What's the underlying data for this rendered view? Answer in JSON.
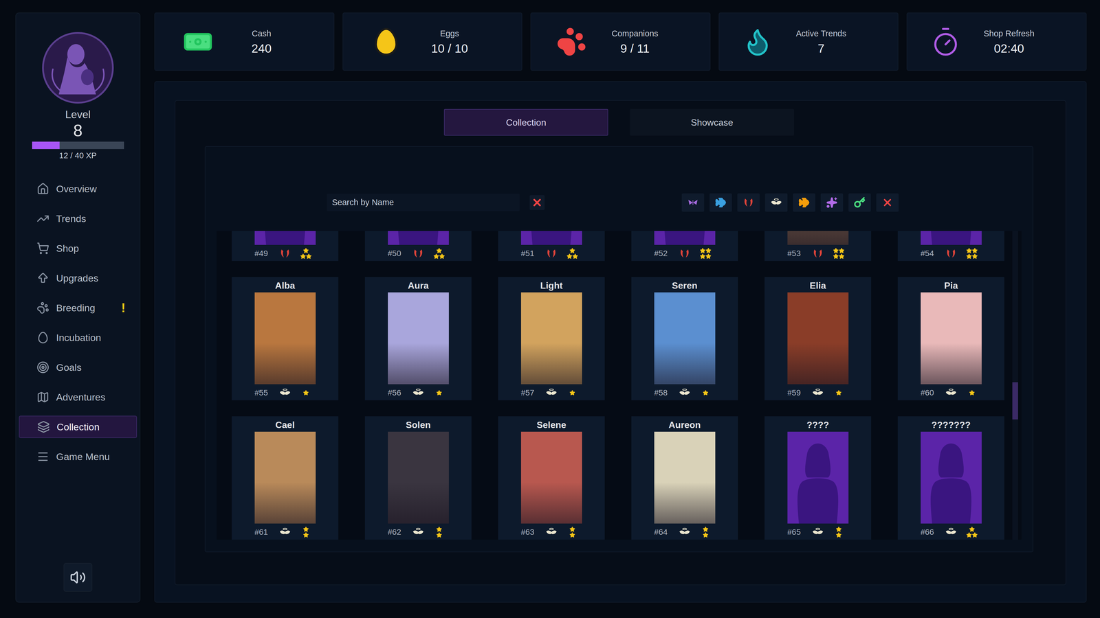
{
  "sidebar": {
    "level_label": "Level",
    "level": "8",
    "xp": {
      "level": 0.3,
      "reading": "12 / 40 XP"
    },
    "items": [
      {
        "label": "Overview",
        "selected": false,
        "badge": ""
      },
      {
        "label": "Trends",
        "selected": false,
        "badge": ""
      },
      {
        "label": "Shop",
        "selected": false,
        "badge": ""
      },
      {
        "label": "Upgrades",
        "selected": false,
        "badge": ""
      },
      {
        "label": "Breeding",
        "selected": false,
        "badge": "!"
      },
      {
        "label": "Incubation",
        "selected": false,
        "badge": ""
      },
      {
        "label": "Goals",
        "selected": false,
        "badge": ""
      },
      {
        "label": "Adventures",
        "selected": false,
        "badge": ""
      },
      {
        "label": "Collection",
        "selected": true,
        "badge": ""
      },
      {
        "label": "Game Menu",
        "selected": false,
        "badge": ""
      }
    ]
  },
  "stats": [
    {
      "label": "Cash",
      "value": "240"
    },
    {
      "label": "Eggs",
      "value": "10 / 10"
    },
    {
      "label": "Companions",
      "value": "9 / 11"
    },
    {
      "label": "Active Trends",
      "value": "7"
    },
    {
      "label": "Shop Refresh",
      "value": "02:40"
    }
  ],
  "tabs": [
    {
      "label": "Collection",
      "selected": true
    },
    {
      "label": "Showcase",
      "selected": false
    }
  ],
  "search": {
    "placeholder": "Search by Name"
  },
  "filters": [
    {
      "kind": "butterfly",
      "color": "#a76be0"
    },
    {
      "kind": "fish",
      "color": "#3aa0e0"
    },
    {
      "kind": "demon",
      "color": "#e0443a"
    },
    {
      "kind": "angel",
      "color": "#ebe6cf"
    },
    {
      "kind": "fish",
      "color": "#f59e0b"
    },
    {
      "kind": "sparkles",
      "color": "#b26be8"
    },
    {
      "kind": "key",
      "color": "#4ade80"
    },
    {
      "kind": "clear",
      "color": "#ef4444"
    }
  ],
  "cards": [
    {
      "number": "#49",
      "kind": "demon",
      "stars": 3,
      "discovered": false,
      "color": "#5b24a8"
    },
    {
      "number": "#50",
      "kind": "demon",
      "stars": 3,
      "discovered": false,
      "color": "#5b24a8"
    },
    {
      "number": "#51",
      "kind": "demon",
      "stars": 3,
      "discovered": false,
      "color": "#5b24a8"
    },
    {
      "number": "#52",
      "kind": "demon",
      "stars": 4,
      "discovered": false,
      "color": "#5b24a8"
    },
    {
      "number": "#53",
      "kind": "demon",
      "stars": 4,
      "discovered": true,
      "color": "#6b5244"
    },
    {
      "number": "#54",
      "kind": "demon",
      "stars": 4,
      "discovered": false,
      "color": "#5b24a8"
    },
    {
      "name": "Alba",
      "number": "#55",
      "kind": "angel",
      "stars": 1,
      "discovered": true,
      "color": "#b9773f"
    },
    {
      "name": "Aura",
      "number": "#56",
      "kind": "angel",
      "stars": 1,
      "discovered": true,
      "color": "#a9a6dc"
    },
    {
      "name": "Light",
      "number": "#57",
      "kind": "angel",
      "stars": 1,
      "discovered": true,
      "color": "#d2a35e"
    },
    {
      "name": "Seren",
      "number": "#58",
      "kind": "angel",
      "stars": 1,
      "discovered": true,
      "color": "#5b8fd0"
    },
    {
      "name": "Elia",
      "number": "#59",
      "kind": "angel",
      "stars": 1,
      "discovered": true,
      "color": "#8a3d28"
    },
    {
      "name": "Pia",
      "number": "#60",
      "kind": "angel",
      "stars": 1,
      "discovered": true,
      "color": "#e9b9b9"
    },
    {
      "name": "Cael",
      "number": "#61",
      "kind": "angel",
      "stars": 2,
      "discovered": true,
      "color": "#b98a5a"
    },
    {
      "name": "Solen",
      "number": "#62",
      "kind": "angel",
      "stars": 2,
      "discovered": true,
      "color": "#3a3540"
    },
    {
      "name": "Selene",
      "number": "#63",
      "kind": "angel",
      "stars": 2,
      "discovered": true,
      "color": "#b8584f"
    },
    {
      "name": "Aureon",
      "number": "#64",
      "kind": "angel",
      "stars": 2,
      "discovered": true,
      "color": "#d9d2b8"
    },
    {
      "name": "????",
      "number": "#65",
      "kind": "angel",
      "stars": 2,
      "discovered": false,
      "color": "#5b24a8"
    },
    {
      "name": "???????",
      "number": "#66",
      "kind": "angel",
      "stars": 3,
      "discovered": false,
      "color": "#5b24a8"
    }
  ],
  "scrollbar": {
    "level": 0.556
  }
}
